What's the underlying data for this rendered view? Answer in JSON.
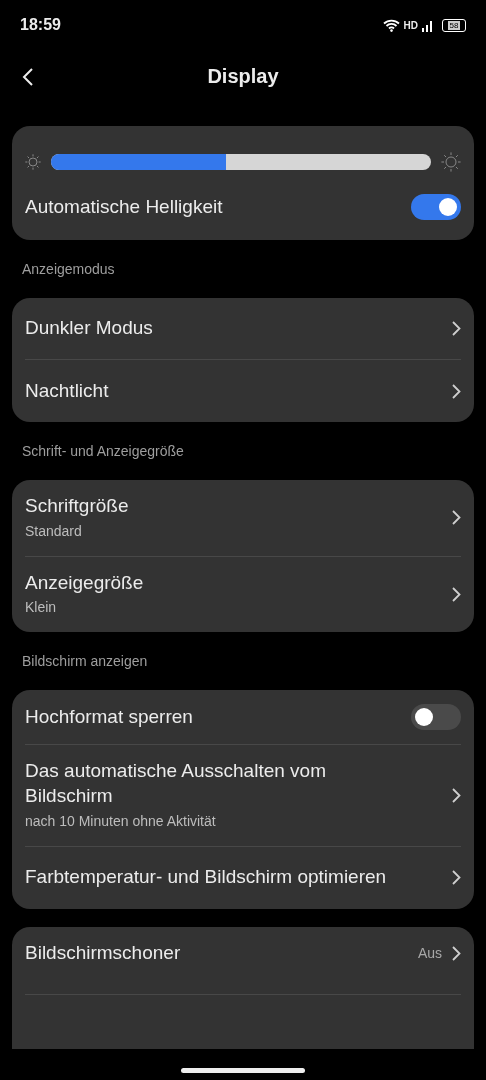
{
  "status_bar": {
    "time": "18:59",
    "network": "HD",
    "battery": "58"
  },
  "title": "Display",
  "sections": [
    {
      "rows": [
        {
          "kind": "slider",
          "level": 0.46
        },
        {
          "kind": "toggle",
          "title": "Automatische Helligkeit",
          "on": true
        }
      ]
    },
    {
      "header": "Anzeigemodus",
      "rows": [
        {
          "kind": "link",
          "title": "Dunkler Modus"
        },
        {
          "kind": "link",
          "title": "Nachtlicht"
        }
      ]
    },
    {
      "header": "Schrift- und Anzeigegröße",
      "rows": [
        {
          "kind": "link",
          "title": "Schriftgröße",
          "subtitle": "Standard"
        },
        {
          "kind": "link",
          "title": "Anzeigegröße",
          "subtitle": "Klein"
        }
      ]
    },
    {
      "header": "Bildschirm anzeigen",
      "rows": [
        {
          "kind": "toggle",
          "title": "Hochformat sperren",
          "on": false
        },
        {
          "kind": "link",
          "title": "Das automatische Ausschalten vom Bildschirm",
          "subtitle": "nach 10 Minuten ohne Aktivität"
        },
        {
          "kind": "link",
          "title": "Farbtemperatur- und Bildschirm optimieren"
        }
      ]
    },
    {
      "rows": [
        {
          "kind": "link",
          "title": "Bildschirmschoner",
          "value": "Aus"
        }
      ],
      "cut": true
    }
  ]
}
